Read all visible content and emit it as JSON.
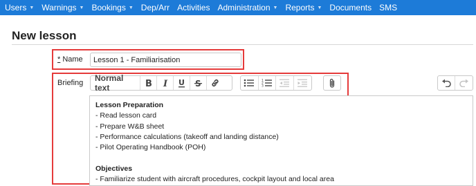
{
  "nav": {
    "items": [
      {
        "label": "Users",
        "caret": true
      },
      {
        "label": "Warnings",
        "caret": true
      },
      {
        "label": "Bookings",
        "caret": true
      },
      {
        "label": "Dep/Arr",
        "caret": false
      },
      {
        "label": "Activities",
        "caret": false
      },
      {
        "label": "Administration",
        "caret": true
      },
      {
        "label": "Reports",
        "caret": true
      },
      {
        "label": "Documents",
        "caret": false
      },
      {
        "label": "SMS",
        "caret": false
      }
    ],
    "bg_color": "#1d7bd8",
    "caret_glyph": "▼"
  },
  "page": {
    "title": "New lesson"
  },
  "form": {
    "name_required_mark": "*",
    "name_label": " Name",
    "name_value": "Lesson 1 - Familiarisation",
    "briefing_label": "Briefing"
  },
  "toolbar": {
    "format_label": "Normal text",
    "icons": [
      "bold-icon",
      "italic-icon",
      "underline-icon",
      "strikethrough-icon",
      "link-icon",
      "bullet-list-icon",
      "numbered-list-icon",
      "outdent-icon",
      "indent-icon",
      "attachment-icon",
      "undo-icon",
      "redo-icon"
    ]
  },
  "editor": {
    "lines": [
      {
        "text": "Lesson Preparation",
        "bold": true
      },
      {
        "text": "- Read lesson card",
        "bold": false
      },
      {
        "text": "- Prepare W&B sheet",
        "bold": false
      },
      {
        "text": "- Performance calculations (takeoff and landing distance)",
        "bold": false
      },
      {
        "text": "- Pilot Operating Handbook (POH)",
        "bold": false
      },
      {
        "text": "",
        "bold": false
      },
      {
        "text": "Objectives",
        "bold": true
      },
      {
        "text": "- Familiarize student with aircraft procedures, cockpit layout and local area",
        "bold": false
      }
    ]
  },
  "highlight_color": "#e53a3a"
}
